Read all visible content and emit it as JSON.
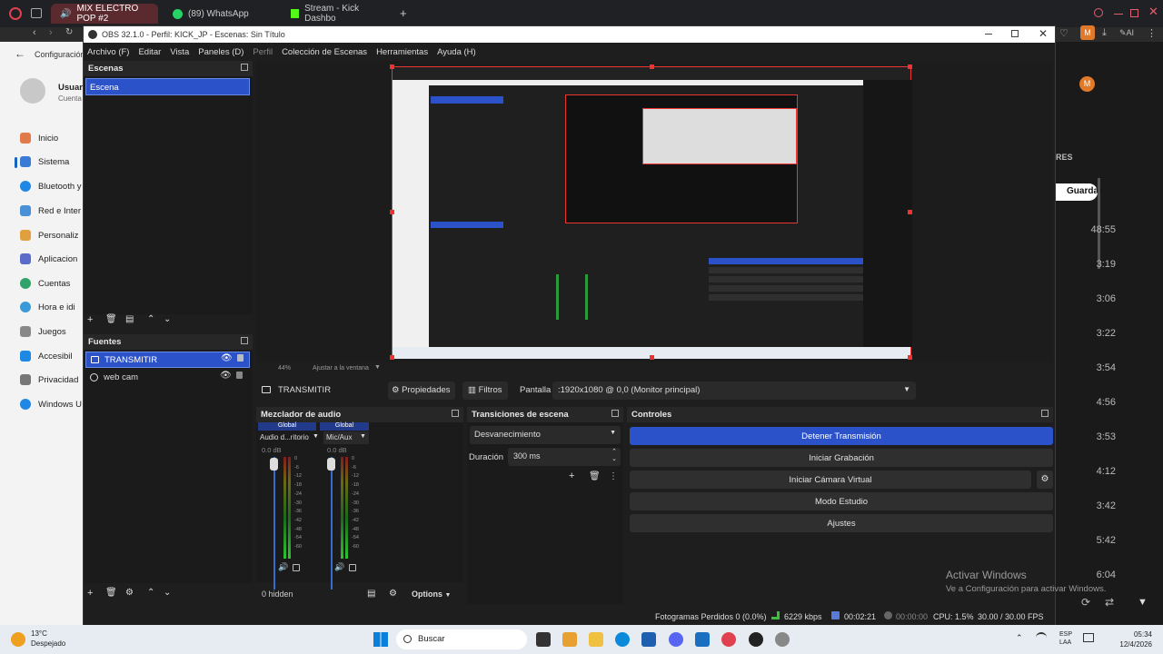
{
  "browser": {
    "tabs": [
      {
        "label": "MIX ELECTRO POP #2"
      },
      {
        "label": "(89) WhatsApp"
      },
      {
        "label": "Stream - Kick Dashbo"
      }
    ],
    "new_tab": "+"
  },
  "settings": {
    "header": "Configuración",
    "user_name": "Usuar",
    "user_sub": "Cuenta",
    "items": [
      "Inicio",
      "Sistema",
      "Bluetooth y",
      "Red e Inter",
      "Personaliz",
      "Aplicacion",
      "Cuentas",
      "Hora e idi",
      "Juegos",
      "Accesibil",
      "Privacidad",
      "Windows U"
    ]
  },
  "right_panel": {
    "header": "RES",
    "save": "Guardar",
    "times": [
      "48:55",
      "3:19",
      "3:06",
      "3:22",
      "3:54",
      "4:56",
      "3:53",
      "4:12",
      "3:42",
      "5:42",
      "6:04"
    ]
  },
  "obs": {
    "title": "OBS 32.1.0 - Perfil: KICK_JP - Escenas: Sin Título",
    "menu": [
      "Archivo (F)",
      "Editar",
      "Vista",
      "Paneles (D)",
      "Perfil",
      "Colección de Escenas",
      "Herramientas",
      "Ayuda (H)"
    ],
    "scenes": {
      "title": "Escenas",
      "items": [
        "Escena"
      ]
    },
    "sources": {
      "title": "Fuentes",
      "items": [
        "TRANSMITIR",
        "web cam"
      ]
    },
    "preview": {
      "zoom": "44%",
      "fit": "Ajustar a la ventana"
    },
    "source_bar": {
      "name": "TRANSMITIR",
      "properties": "Propiedades",
      "filters": "Filtros",
      "display_label": "Pantalla",
      "display_value": ":1920x1080 @ 0,0 (Monitor principal)"
    },
    "mixer": {
      "title": "Mezclador de audio",
      "channels": [
        {
          "tag": "Global",
          "name": "Audio d...ritorio",
          "db": "0.0 dB"
        },
        {
          "tag": "Global",
          "name": "Mic/Aux",
          "db": "0.0 dB"
        }
      ],
      "scale": [
        "0",
        "-6",
        "-12",
        "-18",
        "-24",
        "-30",
        "-36",
        "-42",
        "-48",
        "-54",
        "-60"
      ],
      "hidden": "0 hidden",
      "options": "Options"
    },
    "transitions": {
      "title": "Transiciones de escena",
      "value": "Desvanecimiento",
      "duration_label": "Duración",
      "duration_value": "300 ms"
    },
    "controls": {
      "title": "Controles",
      "buttons": [
        "Detener Transmisión",
        "Iniciar Grabación",
        "Iniciar Cámara Virtual",
        "Modo Estudio",
        "Ajustes"
      ]
    },
    "status": {
      "dropped": "Fotogramas Perdidos 0 (0.0%)",
      "bitrate": "6229 kbps",
      "stream_time": "00:02:21",
      "rec_time": "00:00:00",
      "cpu": "CPU: 1.5%",
      "fps": "30.00 / 30.00 FPS"
    }
  },
  "watermark": {
    "line1": "Activar Windows",
    "line2": "Ve a Configuración para activar Windows."
  },
  "taskbar": {
    "weather_temp": "13°C",
    "weather_desc": "Despejado",
    "search": "Buscar",
    "lang1": "ESP",
    "lang2": "LAA",
    "time": "05:34",
    "date": "12/4/2026"
  },
  "colors": {
    "accent": "#2c52c9",
    "record_red": "#e04040"
  }
}
